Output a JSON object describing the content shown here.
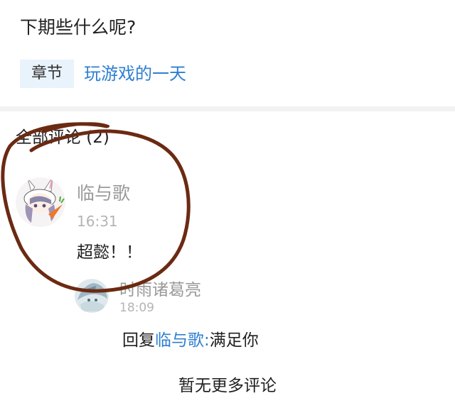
{
  "post": {
    "question": "下期些什么呢?",
    "chapter_tag": "章节",
    "chapter_title": "玩游戏的一天"
  },
  "comments": {
    "header": "全部评论 (2)",
    "main": {
      "author": "临与歌",
      "time": "16:31",
      "text": "超懿！！",
      "avatar_icon": "bunny-girl-avatar-icon"
    },
    "reply": {
      "author": "时雨诸葛亮",
      "time": "18:09",
      "prefix": "回复",
      "target": "临与歌",
      "separator": ":",
      "text": "满足你",
      "avatar_icon": "character-avatar-icon"
    },
    "footer": "暂无更多评论"
  },
  "colors": {
    "link": "#2f7fd0",
    "annotation": "#6b2a12",
    "tag_bg": "#e9f3fb"
  }
}
